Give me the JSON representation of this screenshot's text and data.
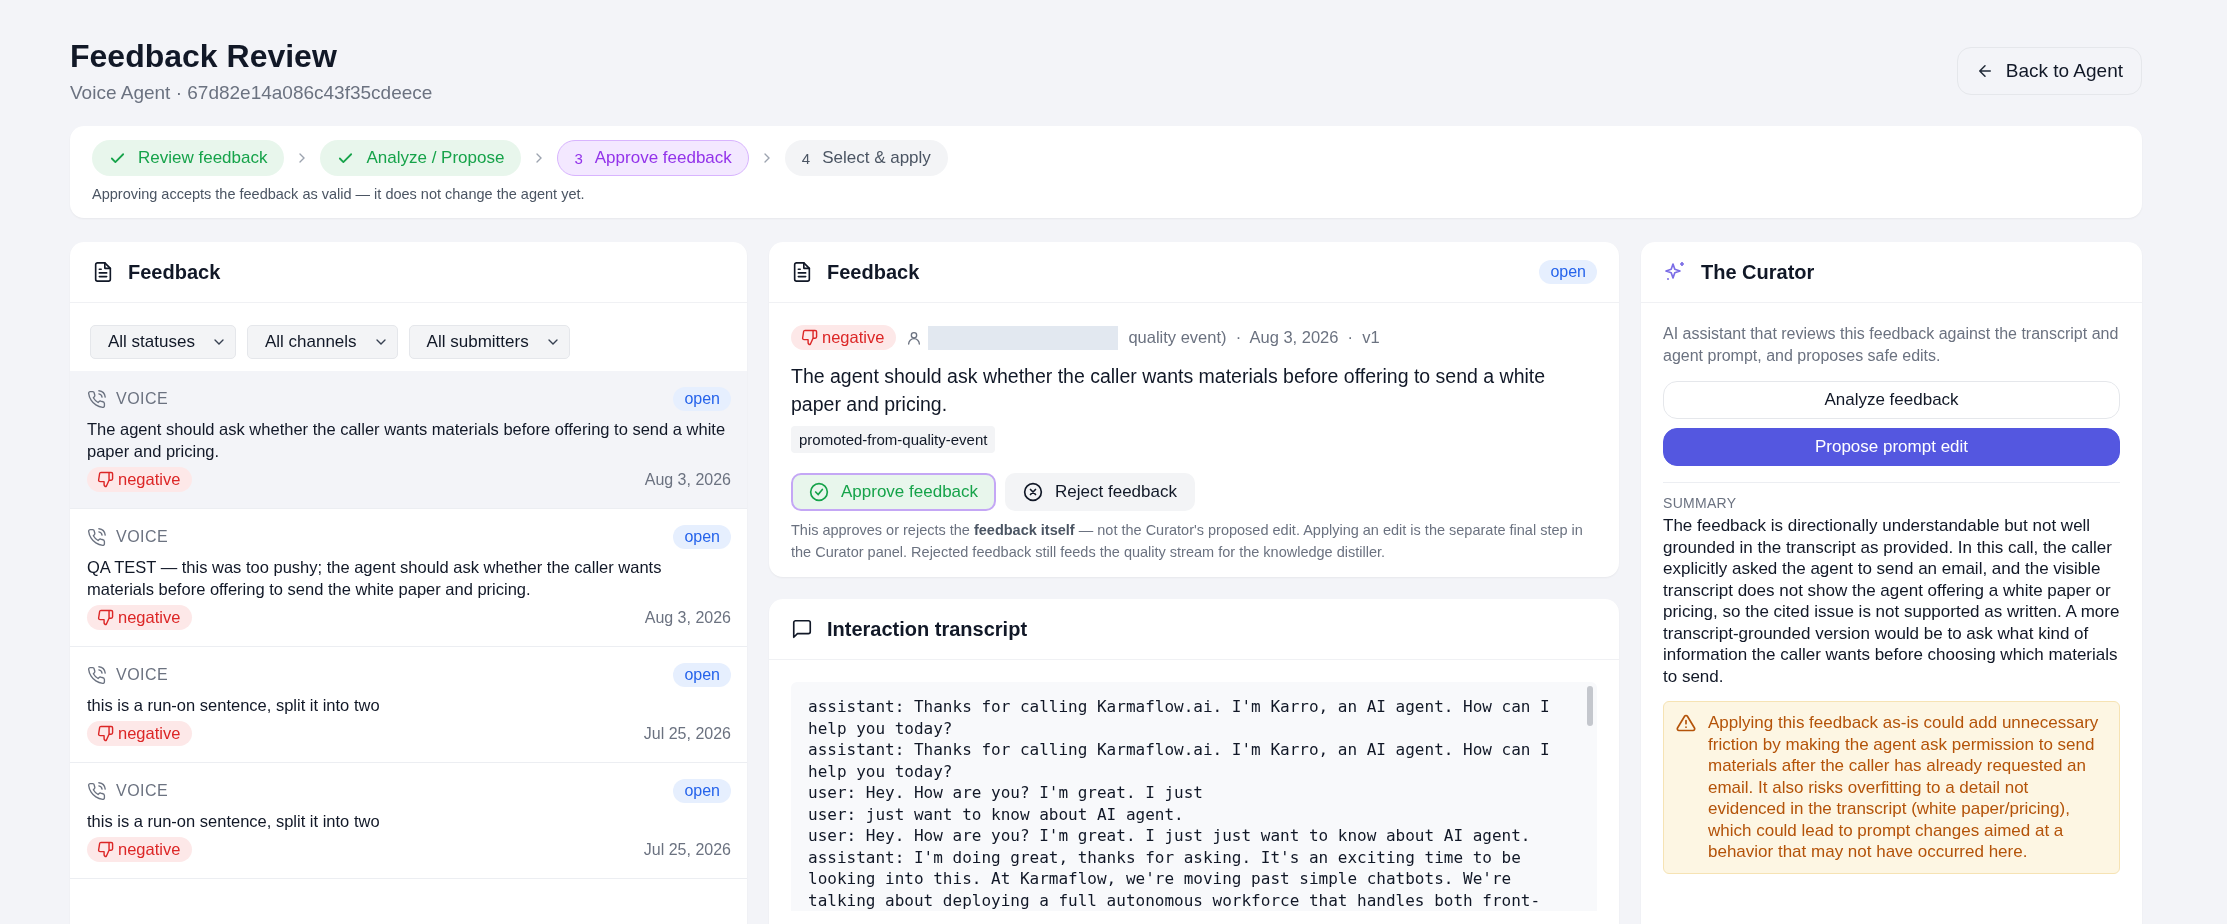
{
  "page": {
    "title": "Feedback Review",
    "subtitle": "Voice Agent · 67d82e14a086c43f35cdeece",
    "back_button": "Back to Agent"
  },
  "stepper": {
    "steps": [
      {
        "label": "Review feedback",
        "completed": true,
        "selected": false
      },
      {
        "label": "Analyze / Propose",
        "completed": true,
        "selected": false
      },
      {
        "number": "3",
        "label": "Approve feedback",
        "completed": false,
        "selected": true
      },
      {
        "number": "4",
        "label": "Select & apply",
        "completed": false,
        "selected": false
      }
    ],
    "note": "Approving accepts the feedback as valid — it does not change the agent yet."
  },
  "feedback_list": {
    "title": "Feedback",
    "filters": [
      "All statuses",
      "All channels",
      "All submitters"
    ],
    "items": [
      {
        "channel": "VOICE",
        "status": "open",
        "text": "The agent should ask whether the caller wants materials before offering to send a white paper and pricing.",
        "sentiment": "negative",
        "date": "Aug 3, 2026",
        "selected": true
      },
      {
        "channel": "VOICE",
        "status": "open",
        "text": "QA TEST — this was too pushy; the agent should ask whether the caller wants materials before offering to send the white paper and pricing.",
        "sentiment": "negative",
        "date": "Aug 3, 2026",
        "selected": false
      },
      {
        "channel": "VOICE",
        "status": "open",
        "text": "this is a run-on sentence, split it into two",
        "sentiment": "negative",
        "date": "Jul 25, 2026",
        "selected": false
      },
      {
        "channel": "VOICE",
        "status": "open",
        "text": "this is a run-on sentence, split it into two",
        "sentiment": "negative",
        "date": "Jul 25, 2026",
        "selected": false
      }
    ]
  },
  "feedback_detail": {
    "title": "Feedback",
    "status": "open",
    "sentiment": "negative",
    "meta": "quality event)  ·  Aug 3, 2026  ·  v1",
    "text": "The agent should ask whether the caller wants materials before offering to send a white paper and pricing.",
    "tags": [
      "promoted-from-quality-event"
    ],
    "approve_button": "Approve feedback",
    "reject_button": "Reject feedback",
    "note": "This approves or rejects the **feedback itself** — not the Curator's proposed edit. Applying an edit is the separate final step in the Curator panel. Rejected feedback still feeds the quality stream for the knowledge distiller."
  },
  "transcript": {
    "title": "Interaction transcript",
    "lines": [
      "assistant: Thanks for calling Karmaflow.ai. I'm Karro, an AI agent. How can I help you today?",
      "assistant: Thanks for calling Karmaflow.ai. I'm Karro, an AI agent. How can I help you today?",
      "user: Hey. How are you? I'm great. I just",
      "user: just want to know about AI agent.",
      "user: Hey. How are you? I'm great. I just just want to know about AI agent.",
      "assistant: I'm doing great, thanks for asking. It's an exciting time to be looking into this. At Karmaflow, we're moving past simple chatbots. We're talking about deploying a full autonomous workforce that handles both front-"
    ]
  },
  "curator": {
    "title": "The Curator",
    "description": "AI assistant that reviews this feedback against the transcript and agent prompt, and proposes safe edits.",
    "analyze_button": "Analyze feedback",
    "propose_button": "Propose prompt edit",
    "summary_label": "SUMMARY",
    "summary": "The feedback is directionally understandable but not well grounded in the transcript as provided. In this call, the caller explicitly asked the agent to send an email, and the visible transcript does not show the agent offering a white paper or pricing, so the cited issue is not supported as written. A more transcript-grounded version would be to ask what kind of information the caller wants before choosing which materials to send.",
    "warning": "Applying this feedback as-is could add unnecessary friction by making the agent ask permission to send materials after the caller has already requested an email. It also risks overfitting to a detail not evidenced in the transcript (white paper/pricing), which could lead to prompt changes aimed at a behavior that may not have occurred here."
  }
}
